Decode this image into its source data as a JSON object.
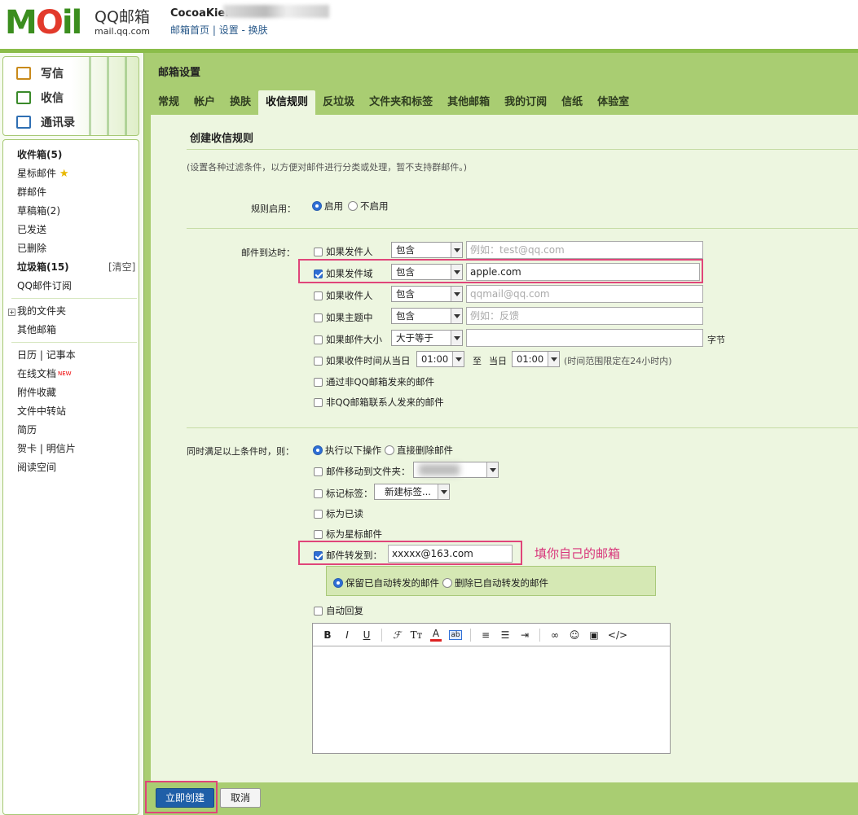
{
  "header": {
    "logo_letters": {
      "m": "M",
      "o": "O",
      "il": "il"
    },
    "logo_brand": "QQ邮箱",
    "logo_domain": "mail.qq.com",
    "username": "CocoaKier",
    "links": [
      "邮箱首页",
      "设置",
      "换肤"
    ]
  },
  "quick": {
    "compose": "写信",
    "receive": "收信",
    "contacts": "通讯录"
  },
  "nav": {
    "inbox": "收件箱(5)",
    "starred": "星标邮件",
    "group": "群邮件",
    "drafts": "草稿箱(2)",
    "sent": "已发送",
    "deleted": "已删除",
    "spam": "垃圾箱(15)",
    "spam_clear": "[清空]",
    "subscribe": "QQ邮件订阅",
    "my_folders": "我的文件夹",
    "other_mail": "其他邮箱",
    "calendar": "日历",
    "notebook": "记事本",
    "docs": "在线文档",
    "docs_badge": "NEW",
    "attachments": "附件收藏",
    "transfer": "文件中转站",
    "resume": "简历",
    "card": "贺卡",
    "postcard": "明信片",
    "reading": "阅读空间"
  },
  "main": {
    "title": "邮箱设置",
    "tabs": [
      "常规",
      "帐户",
      "换肤",
      "收信规则",
      "反垃圾",
      "文件夹和标签",
      "其他邮箱",
      "我的订阅",
      "信纸",
      "体验室"
    ],
    "active_tab": "收信规则"
  },
  "form": {
    "page_title": "创建收信规则",
    "description": "(设置各种过滤条件，以方便对邮件进行分类或处理，暂不支持群邮件。)",
    "enable_label": "规则启用：",
    "enable_on": "启用",
    "enable_off": "不启用",
    "arrive_label": "邮件到达时：",
    "conditions": {
      "sender": {
        "label": "如果发件人",
        "op": "包含",
        "placeholder": "例如：test@qq.com",
        "checked": false
      },
      "domain": {
        "label": "如果发件域",
        "op": "包含",
        "value": "apple.com",
        "checked": true
      },
      "recipient": {
        "label": "如果收件人",
        "op": "包含",
        "placeholder": "qqmail@qq.com",
        "checked": false
      },
      "subject": {
        "label": "如果主题中",
        "op": "包含",
        "placeholder": "例如：反馈",
        "checked": false
      },
      "size": {
        "label": "如果邮件大小",
        "op": "大于等于",
        "unit": "字节",
        "checked": false
      },
      "time": {
        "label": "如果收件时间从当日",
        "from": "01:00",
        "to_label": "至",
        "day_label": "当日",
        "to": "01:00",
        "hint": "(时间范围限定在24小时内)",
        "checked": false
      },
      "non_qq": {
        "label": "通过非QQ邮箱发来的邮件",
        "checked": false
      },
      "non_contact": {
        "label": "非QQ邮箱联系人发来的邮件",
        "checked": false
      }
    },
    "then_label": "同时满足以上条件时，则：",
    "exec_ops": "执行以下操作",
    "delete_direct": "直接删除邮件",
    "actions": {
      "move": {
        "label": "邮件移动到文件夹：",
        "checked": false
      },
      "tag": {
        "label": "标记标签：",
        "value": "新建标签...",
        "checked": false
      },
      "read": {
        "label": "标为已读",
        "checked": false
      },
      "star": {
        "label": "标为星标邮件",
        "checked": false
      },
      "forward": {
        "label": "邮件转发到：",
        "value": "xxxxx@163.com",
        "checked": true
      },
      "keep_fwd": "保留已自动转发的邮件",
      "del_fwd": "删除已自动转发的邮件",
      "auto_reply": {
        "label": "自动回复",
        "checked": false
      }
    },
    "annotation": "填你自己的邮箱",
    "toolbar": [
      "B",
      "I",
      "U",
      "字体",
      "字号",
      "颜色",
      "背景",
      "对齐",
      "列表",
      "缩进",
      "链接",
      "表情",
      "图片",
      "</>"
    ]
  },
  "buttons": {
    "create": "立即创建",
    "cancel": "取消"
  },
  "colors": {
    "accent_green": "#a9cd72",
    "highlight": "#e0457a",
    "primary": "#1f5fa8"
  }
}
